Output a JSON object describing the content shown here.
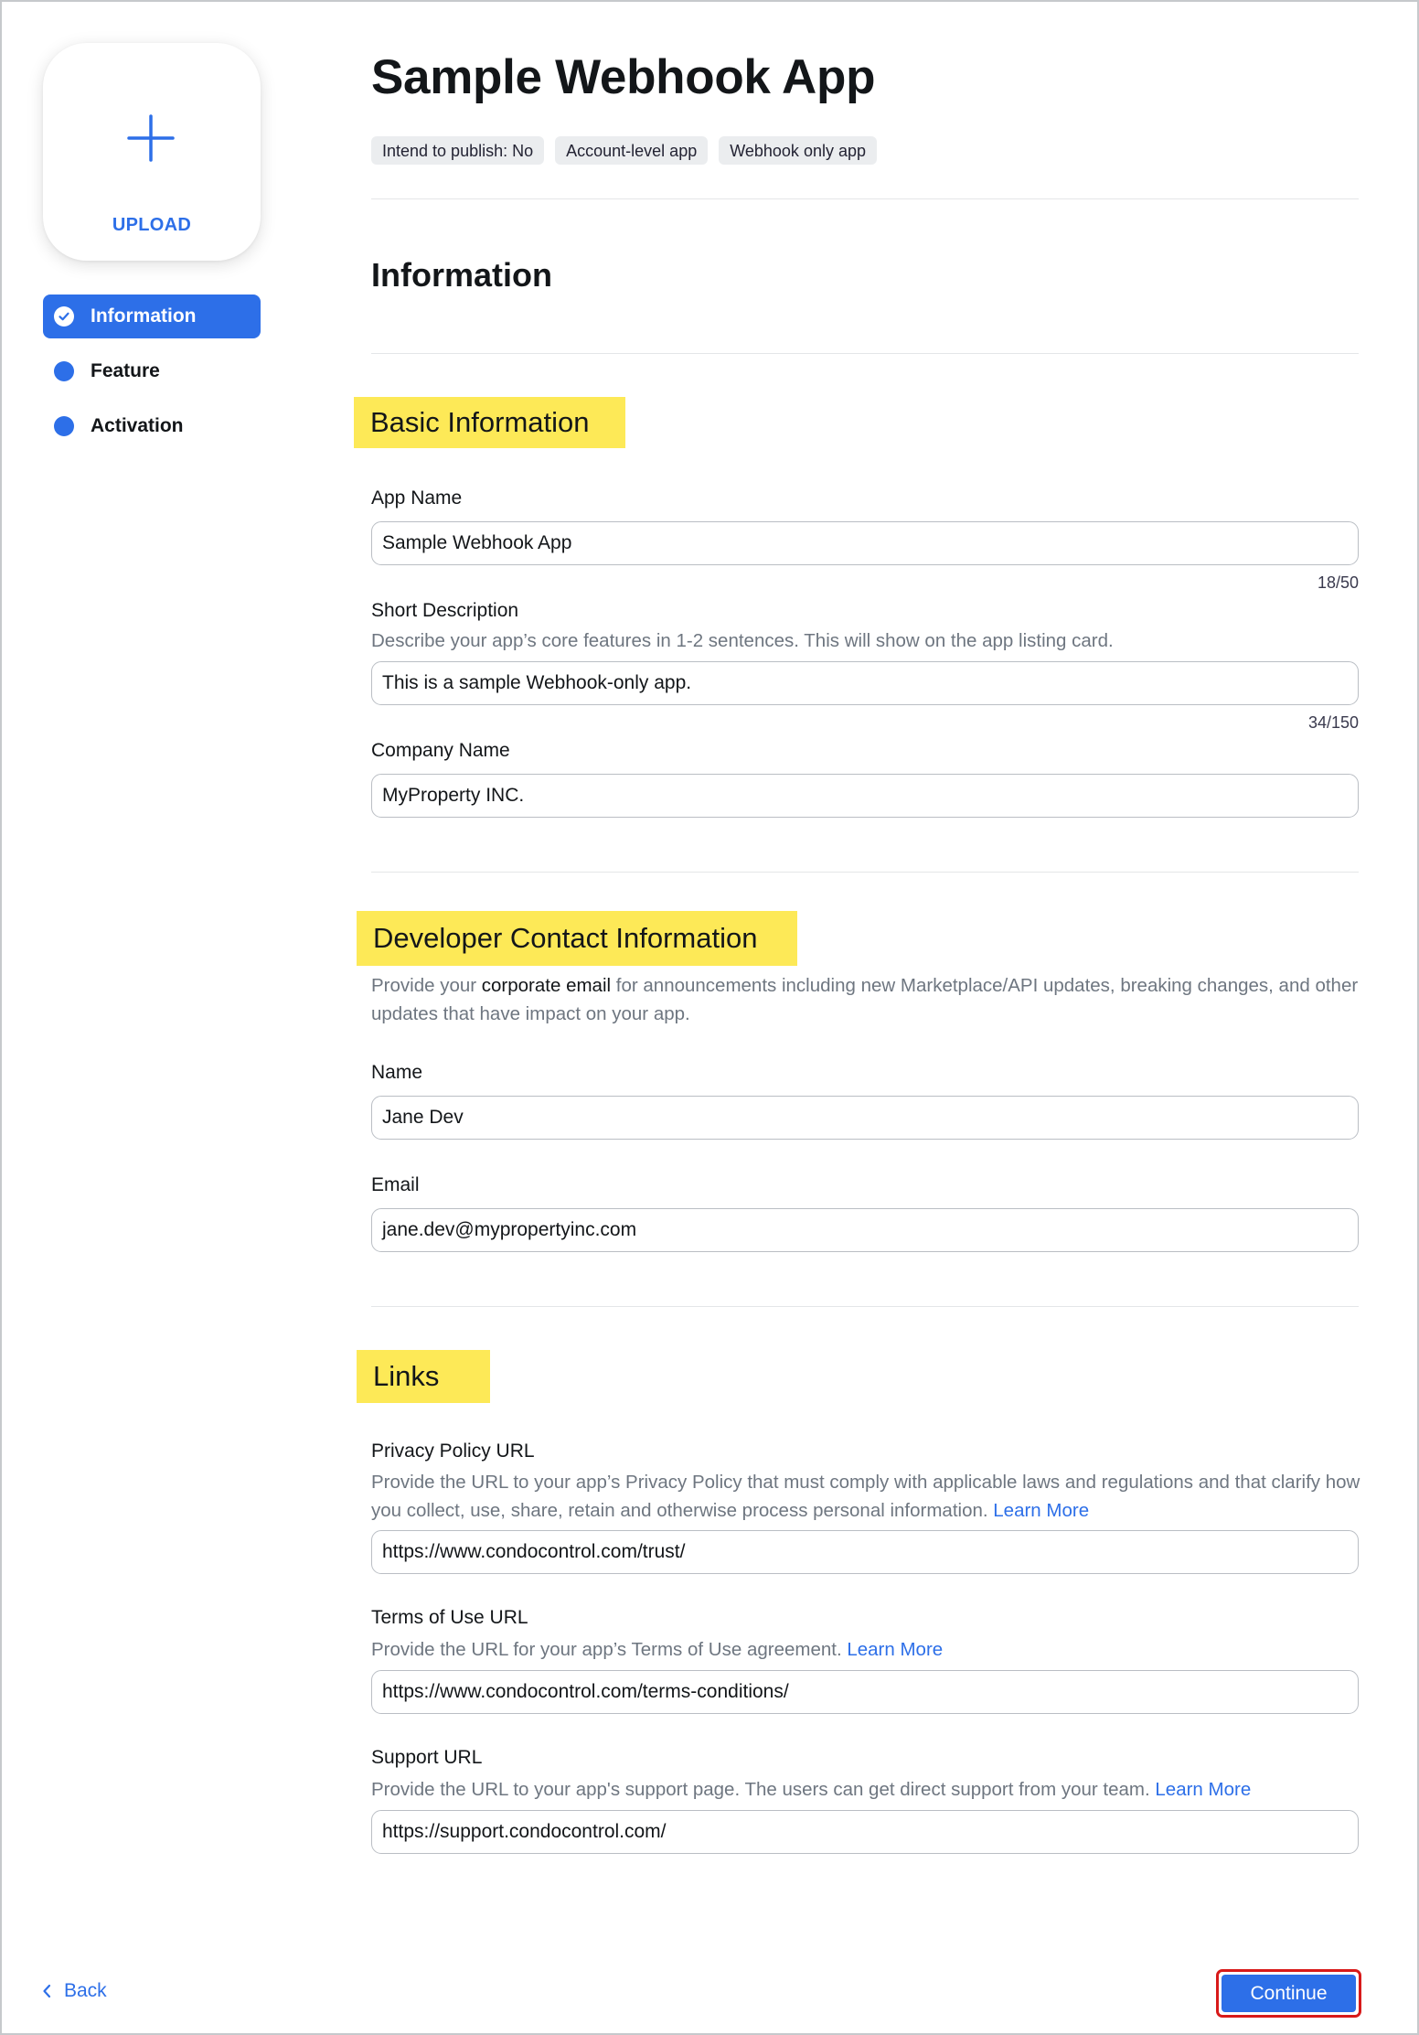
{
  "sidebar": {
    "upload_label": "UPLOAD",
    "nav": [
      {
        "label": "Information",
        "active": true
      },
      {
        "label": "Feature",
        "active": false
      },
      {
        "label": "Activation",
        "active": false
      }
    ]
  },
  "header": {
    "title": "Sample Webhook App",
    "chips": [
      "Intend to publish: No",
      "Account-level app",
      "Webhook only app"
    ]
  },
  "section_title": "Information",
  "basic": {
    "heading": "Basic Information",
    "app_name": {
      "label": "App Name",
      "value": "Sample Webhook App",
      "counter": "18/50"
    },
    "short_description": {
      "label": "Short Description",
      "help": "Describe your app’s core features in 1-2 sentences. This will show on the app listing card.",
      "value": "This is a sample Webhook-only app.",
      "counter": "34/150"
    },
    "company_name": {
      "label": "Company Name",
      "value": "MyProperty INC."
    }
  },
  "developer": {
    "heading": "Developer Contact Information",
    "help_pre": "Provide your ",
    "help_em": "corporate email",
    "help_post": " for announcements including new Marketplace/API updates, breaking changes, and other updates that have impact on your app.",
    "name": {
      "label": "Name",
      "value": "Jane Dev"
    },
    "email": {
      "label": "Email",
      "value": "jane.dev@mypropertyinc.com"
    }
  },
  "links": {
    "heading": "Links",
    "learn_more": "Learn More",
    "privacy": {
      "label": "Privacy Policy URL",
      "help": "Provide the URL to your app’s Privacy Policy that must comply with applicable laws and regulations and that clarify how you collect, use, share, retain and otherwise process personal information. ",
      "value": "https://www.condocontrol.com/trust/"
    },
    "terms": {
      "label": "Terms of Use URL",
      "help": "Provide the URL for your app’s Terms of Use agreement. ",
      "value": "https://www.condocontrol.com/terms-conditions/"
    },
    "support": {
      "label": "Support URL",
      "help": "Provide the URL to your app's support page. The users can get direct support from your team. ",
      "value": "https://support.condocontrol.com/"
    }
  },
  "footer": {
    "back_label": "Back",
    "continue_label": "Continue"
  },
  "colors": {
    "accent": "#2d6fe8",
    "highlight": "#fde957",
    "outline": "#d81a1a"
  }
}
